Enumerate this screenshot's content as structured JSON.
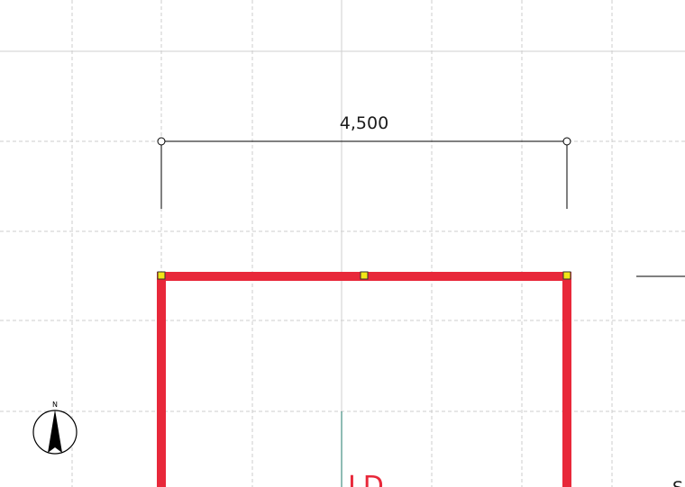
{
  "drawing": {
    "dimension_value": "4,500",
    "room_label": "LD",
    "north_label": "N",
    "edge_label": "S"
  },
  "colors": {
    "wall": "#e8283a",
    "handle": "#f2e516",
    "grid_major": "#cfcfcf",
    "grid_minor": "#cccccc",
    "dimension_line": "#000000",
    "axis_teal": "#1f7a6a"
  },
  "icons": {
    "compass": "north-arrow-icon",
    "handle": "square-handle-icon",
    "dimension_end": "circle-marker-icon"
  }
}
